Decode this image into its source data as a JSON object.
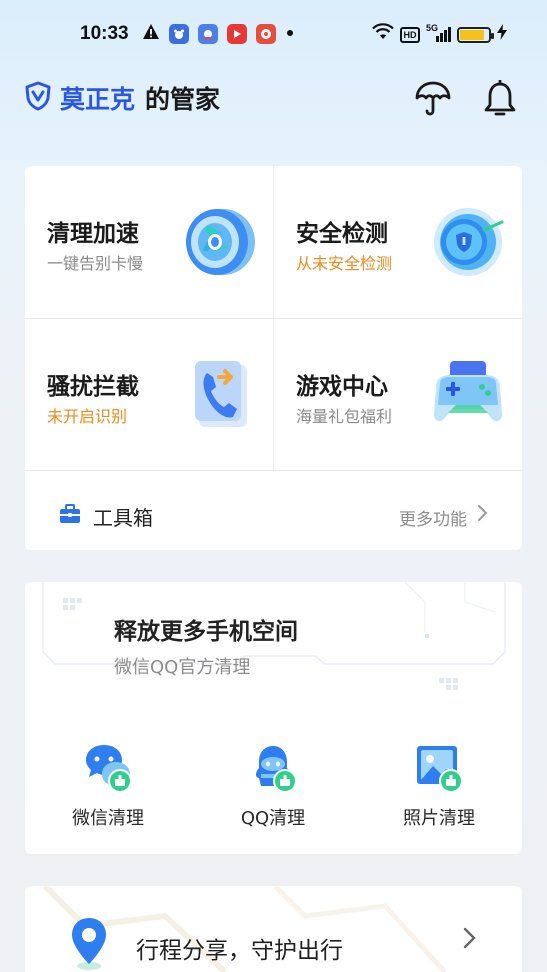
{
  "status_bar": {
    "time": "10:33",
    "network_label": "5G",
    "hd_label": "HD",
    "battery_percent": 85
  },
  "header": {
    "brand_name": "莫正克",
    "brand_suffix": "的管家"
  },
  "features": [
    {
      "title": "清理加速",
      "subtitle": "一键告别卡慢",
      "subtitle_color": "#8a8a8a"
    },
    {
      "title": "安全检测",
      "subtitle": "从未安全检测",
      "subtitle_color": "#f08a1c"
    },
    {
      "title": "骚扰拦截",
      "subtitle": "未开启识别",
      "subtitle_color": "#f08a1c"
    },
    {
      "title": "游戏中心",
      "subtitle": "海量礼包福利",
      "subtitle_color": "#8a8a8a"
    }
  ],
  "toolbox": {
    "label": "工具箱",
    "more_label": "更多功能"
  },
  "release": {
    "title": "释放更多手机空间",
    "subtitle": "微信QQ官方清理",
    "items": [
      {
        "label": "微信清理",
        "icon": "wechat-clean-icon"
      },
      {
        "label": "QQ清理",
        "icon": "qq-clean-icon"
      },
      {
        "label": "照片清理",
        "icon": "photo-clean-icon"
      }
    ]
  },
  "trip": {
    "label": "行程分享，守护出行"
  },
  "colors": {
    "brand_blue": "#2a56e6",
    "warning_orange": "#f08a1c",
    "accent_green": "#2fcf8d"
  }
}
